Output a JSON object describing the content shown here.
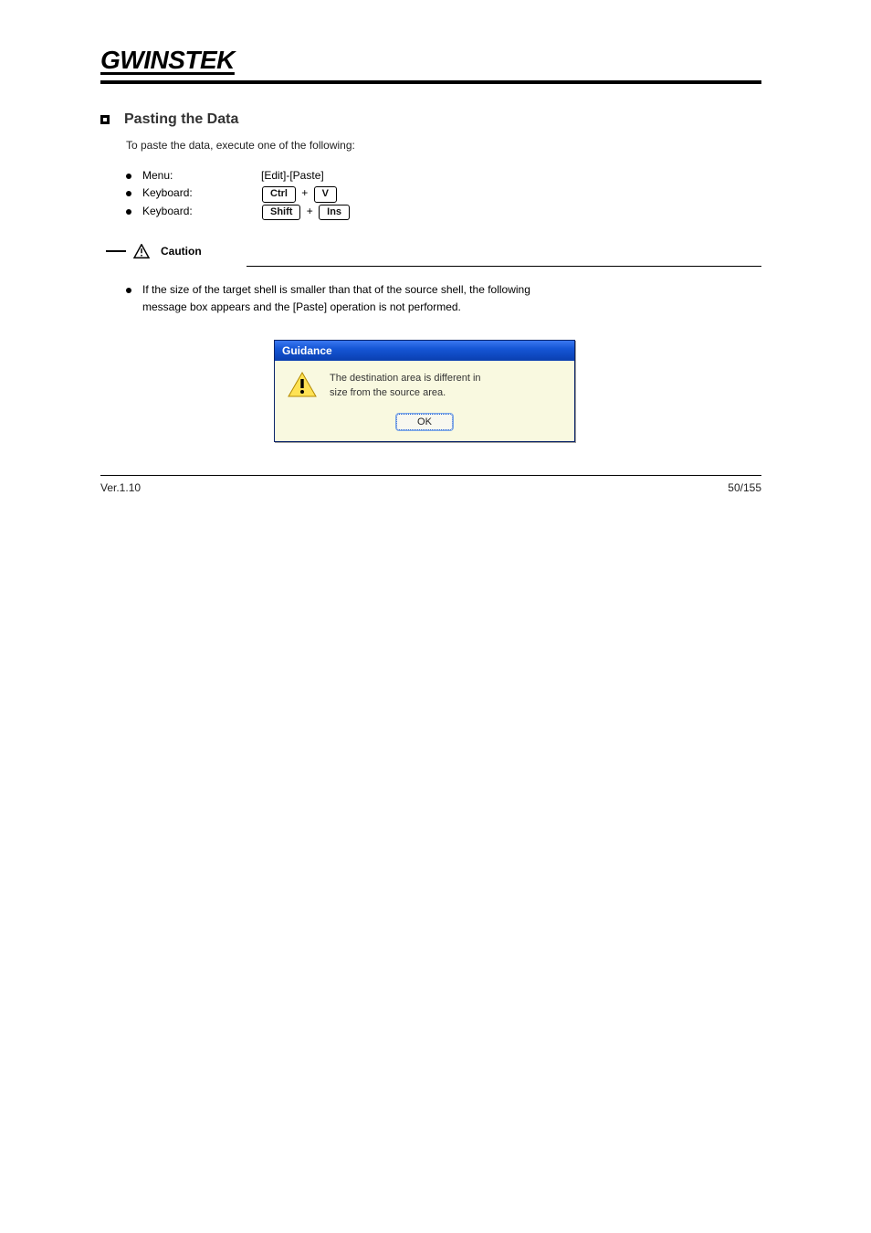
{
  "brand": "GWINSTEK",
  "section": {
    "title": "Pasting the Data",
    "lead": "To paste the data, execute one of the following:"
  },
  "bullets": [
    {
      "label": "Menu:",
      "keys": [
        "[Edit]-[Paste]"
      ]
    },
    {
      "label": "Keyboard:",
      "keys": [
        "Ctrl",
        "+",
        "V"
      ]
    },
    {
      "label": "Keyboard:",
      "keys": [
        "Shift",
        "+",
        "Ins"
      ]
    }
  ],
  "caution": {
    "word": "Caution",
    "noteLine1": "If the size of the target shell is smaller than that of the source shell, the following",
    "noteLine2": "message box appears and the [Paste] operation is not performed."
  },
  "dialog": {
    "title": "Guidance",
    "msgLine1": "The destination area is different in",
    "msgLine2": "size from the source area.",
    "ok": "OK"
  },
  "footer": {
    "left": "Ver.1.10",
    "right": "50/155"
  },
  "icons": {
    "warningTriangle": "warning-icon",
    "dialogWarning": "dialog-warning-icon"
  }
}
